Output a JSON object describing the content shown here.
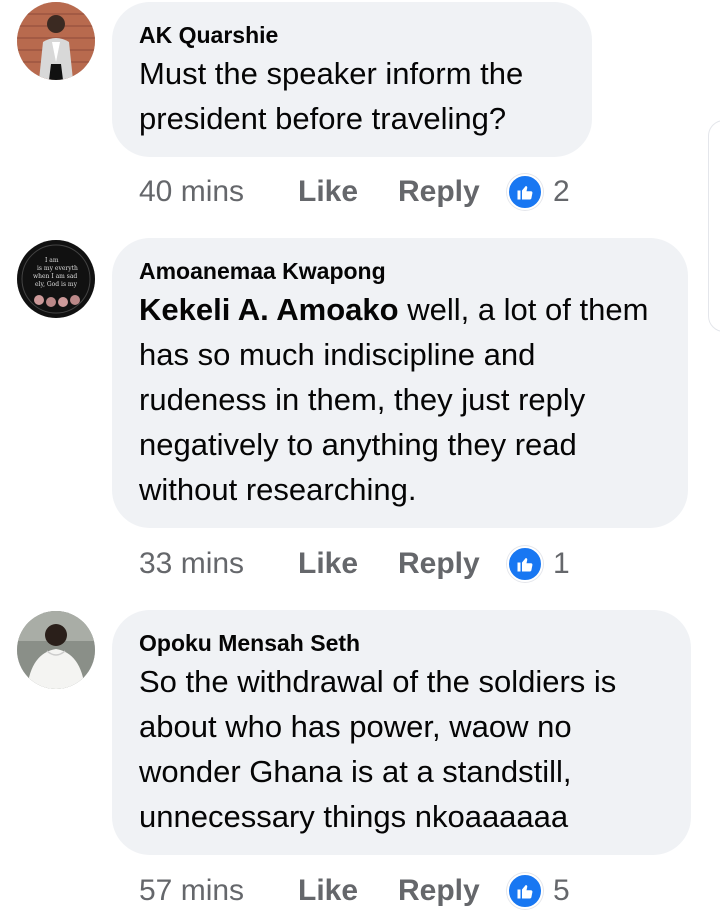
{
  "comments": [
    {
      "author": "AK Quarshie",
      "mention": "",
      "text": "Must the speaker inform the president before traveling?",
      "time": "40 mins",
      "like_label": "Like",
      "reply_label": "Reply",
      "reaction_icon": "thumbs-up-icon",
      "reaction_count": "2"
    },
    {
      "author": "Amoanemaa Kwapong",
      "mention": "Kekeli A. Amoako",
      "text": " well, a lot of them has so much indiscipline and rudeness in them, they just reply negatively to anything they read without researching.",
      "time": "33 mins",
      "like_label": "Like",
      "reply_label": "Reply",
      "reaction_icon": "thumbs-up-icon",
      "reaction_count": "1"
    },
    {
      "author": "Opoku Mensah Seth",
      "mention": "",
      "text": "So the withdrawal of the soldiers is about who has power, waow no wonder Ghana is at a standstill, unnecessary things nkoaaaaaa",
      "time": "57 mins",
      "like_label": "Like",
      "reply_label": "Reply",
      "reaction_icon": "thumbs-up-icon",
      "reaction_count": "5"
    }
  ],
  "colors": {
    "bubble": "#f0f2f5",
    "secondary_text": "#65676b",
    "like_blue": "#1877f2"
  }
}
